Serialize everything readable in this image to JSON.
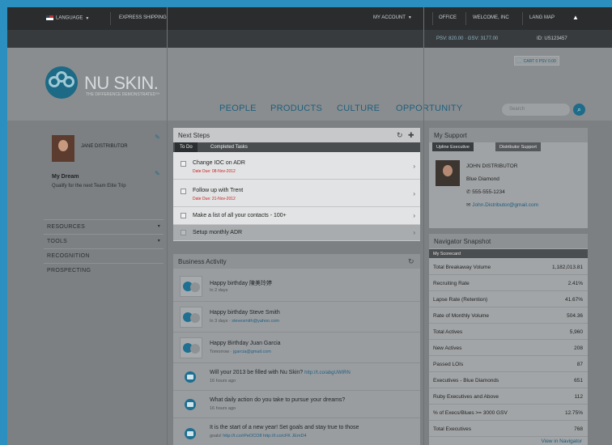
{
  "topbar": {
    "language": "LANGUAGE",
    "express_shipping": "EXPRESS SHIPPING",
    "my_account": "MY ACCOUNT",
    "office": "OFFICE",
    "welcome": "WELCOME, INC",
    "lang_map": "LANG MAP",
    "sub_left": "PSV: 820.00 · GSV: 3177.00",
    "sub_right": "ID: US123457"
  },
  "header": {
    "brand": "NU SKIN.",
    "tagline": "THE DIFFERENCE DEMONSTRATED™",
    "cart": "CART 0 PSV 0.00",
    "nav": [
      "PEOPLE",
      "PRODUCTS",
      "CULTURE",
      "OPPORTUNITY"
    ],
    "search_placeholder": "Search"
  },
  "sidebar": {
    "name": "JANE DISTRIBUTOR",
    "dream_title": "My Dream",
    "dream_text": "Qualify for the next Team Elite Trip",
    "items": [
      "RESOURCES",
      "TOOLS",
      "RECOGNITION",
      "PROSPECTING"
    ]
  },
  "next_steps": {
    "title": "Next Steps",
    "tabs": [
      "To Do",
      "Completed Tasks"
    ],
    "tasks": [
      {
        "title": "Change IOC on ADR",
        "due": "Date Due: 08-Nov-2012"
      },
      {
        "title": "Follow up with Trent",
        "due": "Date Due: 21-Nov-2012"
      },
      {
        "title": "Make a list of all your contacts - 100+",
        "due": ""
      },
      {
        "title": "Setup monthly ADR",
        "due": ""
      }
    ]
  },
  "business_activity": {
    "title": "Business Activity",
    "items": [
      {
        "title": "Happy birthday 陳美玲婷",
        "sub": "In 2 days",
        "link": ""
      },
      {
        "title": "Happy birthday Steve Smith",
        "sub": "In 3 days",
        "link": "stevesmith@yahoo.com"
      },
      {
        "title": "Happy Birthday Juan Garcia",
        "sub": "Tomorrow",
        "link": "jgarcia@gmail.com"
      },
      {
        "title": "Will your 2013 be filled with Nu Skin?",
        "sub": "16 hours ago",
        "link": "http://t.co/abgUWIRN"
      },
      {
        "title": "What daily action do you take to pursue your dreams?",
        "sub": "16 hours ago",
        "link": ""
      },
      {
        "title": "It is the start of a new year! Set goals and stay true to those",
        "sub": "goals!",
        "link": "http://t.co/rPeOCO8 http://t.co/cFK JEmD4"
      }
    ]
  },
  "support": {
    "title": "My Support",
    "tabs": [
      "Upline Executive",
      "Distributor Support"
    ],
    "name": "JOHN DISTRIBUTOR",
    "rank": "Blue Diamond",
    "phone": "555-555-1234",
    "email": "John.Distributor@gmail.com"
  },
  "navigator": {
    "title": "Navigator Snapshot",
    "tab": "My Scorecard",
    "rows": [
      {
        "label": "Total Breakaway Volume",
        "value": "1,182,013.81"
      },
      {
        "label": "Recruiting Rate",
        "value": "2.41%"
      },
      {
        "label": "Lapse Rate (Retention)",
        "value": "41.67%"
      },
      {
        "label": "Rate of Monthly Volume",
        "value": "504.36"
      },
      {
        "label": "Total Actives",
        "value": "5,960"
      },
      {
        "label": "New Actives",
        "value": "208"
      },
      {
        "label": "Passed LOIs",
        "value": "87"
      },
      {
        "label": "Executives - Blue Diamonds",
        "value": "651"
      },
      {
        "label": "Ruby Executives and Above",
        "value": "112"
      },
      {
        "label": "% of Execs/Blues >= 3000 GSV",
        "value": "12.75%"
      },
      {
        "label": "Total Executives",
        "value": "768"
      }
    ],
    "more": "View in Navigator"
  }
}
